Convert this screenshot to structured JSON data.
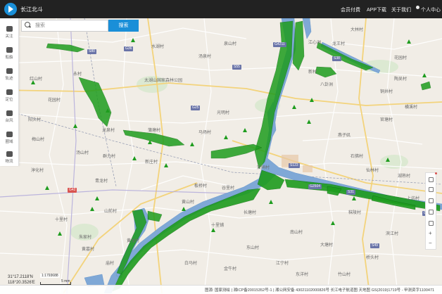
{
  "app": {
    "title": "长江北斗"
  },
  "header": {
    "nav": [
      {
        "label": "会员付费"
      },
      {
        "label": "APP下载"
      },
      {
        "label": "关于我们"
      },
      {
        "label": "个人中心"
      }
    ]
  },
  "sidebar": {
    "items": [
      {
        "label": "关注",
        "icon": "ship-icon"
      },
      {
        "label": "船舶",
        "icon": "boat-icon"
      },
      {
        "label": "轨迹",
        "icon": "track-icon"
      },
      {
        "label": "定位",
        "icon": "location-icon"
      },
      {
        "label": "台风",
        "icon": "typhoon-icon"
      },
      {
        "label": "圈域",
        "icon": "area-icon"
      },
      {
        "label": "物流",
        "icon": "logistics-icon"
      }
    ]
  },
  "search": {
    "placeholder": "搜索",
    "button_label": "搜索"
  },
  "map": {
    "colors": {
      "water": "#7fa8d6",
      "ship": "#1e9c1e",
      "land": "#f1ede6",
      "road": "#ffffff",
      "highway": "#f3d37b",
      "rail": "#9aa0b5"
    },
    "places": [
      {
        "name": "江心洲"
      },
      {
        "name": "太湖山国家森林公园"
      },
      {
        "name": "水湖村"
      },
      {
        "name": "汤泉村"
      },
      {
        "name": "泉山村"
      },
      {
        "name": "红山村"
      },
      {
        "name": "永村"
      },
      {
        "name": "花园村"
      },
      {
        "name": "阳头村"
      },
      {
        "name": "龙泉村"
      },
      {
        "name": "蒲塘村"
      },
      {
        "name": "光明村"
      },
      {
        "name": "梅山村"
      },
      {
        "name": "汤山村"
      },
      {
        "name": "群力村"
      },
      {
        "name": "新庄村"
      },
      {
        "name": "马场村"
      },
      {
        "name": "淳化村"
      },
      {
        "name": "青龙村"
      },
      {
        "name": "十里村"
      },
      {
        "name": "山前村"
      },
      {
        "name": "朱家村"
      },
      {
        "name": "黄墓村"
      },
      {
        "name": "板桥村"
      },
      {
        "name": "谷里村"
      },
      {
        "name": "黄山村"
      },
      {
        "name": "双闸村"
      },
      {
        "name": "十里铺"
      },
      {
        "name": "庙村"
      },
      {
        "name": "新村"
      },
      {
        "name": "八卦洲"
      },
      {
        "name": "燕子矶"
      },
      {
        "name": "仙林村"
      },
      {
        "name": "湖熟村"
      },
      {
        "name": "上坊村"
      },
      {
        "name": "秣陵村"
      },
      {
        "name": "滨江村"
      },
      {
        "name": "南山村"
      },
      {
        "name": "大塘村"
      },
      {
        "name": "桥头村"
      },
      {
        "name": "东山村"
      },
      {
        "name": "江宁村"
      },
      {
        "name": "陶吴村"
      },
      {
        "name": "横溪村"
      },
      {
        "name": "铜井村"
      },
      {
        "name": "石佛村"
      },
      {
        "name": "龙王村"
      },
      {
        "name": "大林村"
      },
      {
        "name": "花园村"
      },
      {
        "name": "官塘村"
      },
      {
        "name": "黄龙村"
      },
      {
        "name": "长塘村"
      },
      {
        "name": "金牛村"
      },
      {
        "name": "白马村"
      },
      {
        "name": "东洋村"
      },
      {
        "name": "竹山村"
      }
    ],
    "routes": [
      {
        "label": "G36"
      },
      {
        "label": "S80"
      },
      {
        "label": "G25"
      },
      {
        "label": "G42"
      },
      {
        "label": "S55"
      },
      {
        "label": "G4211"
      },
      {
        "label": "S38"
      },
      {
        "label": "G2504"
      },
      {
        "label": "S31"
      },
      {
        "label": "G104"
      },
      {
        "label": "S49"
      },
      {
        "label": "S123"
      }
    ]
  },
  "status": {
    "lat": "31°17.2118'N",
    "lon": "118°20.3526'E",
    "scale_ratio": "1:1793688",
    "scale_km": "5 mm"
  },
  "footer": {
    "text": "图源: 国家测绘 | 湘ICP备20015352号-1 | 湘公网安备 43021102000826号 长江电子航道图 天地图 GS(2019)1719号 - 甲测资字1100471"
  },
  "tools": {
    "zoom_in": "+",
    "zoom_out": "−"
  }
}
